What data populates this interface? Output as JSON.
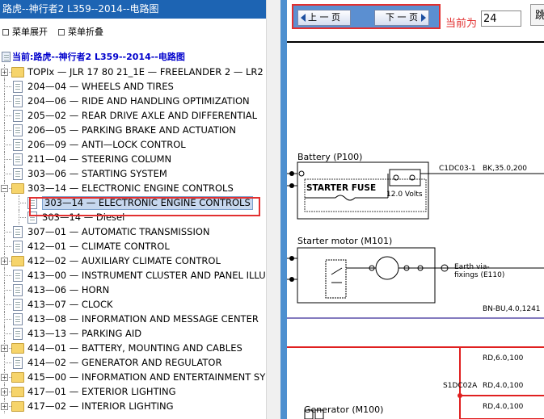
{
  "left_panel": {
    "title": "路虎--神行者2 L359--2014--电路图",
    "expand_label": "菜单展开",
    "collapse_label": "菜单折叠",
    "tree_root": "当前:路虎--神行者2 L359--2014--电路图",
    "items": [
      "TOPIx — JLR 17 80 21_1E — FREELANDER 2 — LR2",
      "204—04 — WHEELS AND TIRES",
      "204—06 — RIDE AND HANDLING OPTIMIZATION",
      "205—02 — REAR DRIVE AXLE AND DIFFERENTIAL",
      "206—05 — PARKING BRAKE AND ACTUATION",
      "206—09 — ANTI—LOCK CONTROL",
      "211—04 — STEERING COLUMN",
      "303—06 — STARTING SYSTEM",
      "303—14 — ELECTRONIC ENGINE CONTROLS",
      "303—14 — ELECTRONIC ENGINE CONTROLS",
      "303—14 — Diesel",
      "307—01 — AUTOMATIC TRANSMISSION",
      "412—01 — CLIMATE CONTROL",
      "412—02 — AUXILIARY CLIMATE CONTROL",
      "413—00 — INSTRUMENT CLUSTER AND PANEL ILLU",
      "413—06 — HORN",
      "413—07 — CLOCK",
      "413—08 — INFORMATION AND MESSAGE CENTER",
      "413—13 — PARKING AID",
      "414—01 — BATTERY, MOUNTING AND CABLES",
      "414—02 — GENERATOR AND REGULATOR",
      "415—00 — INFORMATION AND ENTERTAINMENT SY",
      "417—01 — EXTERIOR LIGHTING",
      "417—02 — INTERIOR LIGHTING"
    ]
  },
  "toolbar": {
    "prev_label": "上 一 页",
    "next_label": "下 一 页",
    "current_label": "当前为",
    "current_page": "24",
    "jump_label": "跳"
  },
  "diagram": {
    "battery_label": "Battery (P100)",
    "starter_fuse_label": "STARTER FUSE",
    "voltage_label": "12.0 Volts",
    "connector_c1dc03": "C1DC03-1",
    "wire_bk": "BK,35.0,200",
    "starter_motor_label": "Starter motor (M101)",
    "earth_label_1": "Earth via-",
    "earth_label_2": "fixings (E110)",
    "wire_bn_bu": "BN-BU,4.0,1241",
    "wire_rd_6": "RD,6.0,100",
    "splice_label": "S1DC02A",
    "wire_rd_4a": "RD,4.0,100",
    "wire_rd_4b": "RD,4.0,100",
    "generator_label": "Generator (M100)"
  },
  "colors": {
    "title_bar": "#1d64b3",
    "splitter": "#4d8fcf",
    "highlight_red": "#e23030",
    "wire_red": "#e02020",
    "wire_purple": "#5a4fa8"
  }
}
